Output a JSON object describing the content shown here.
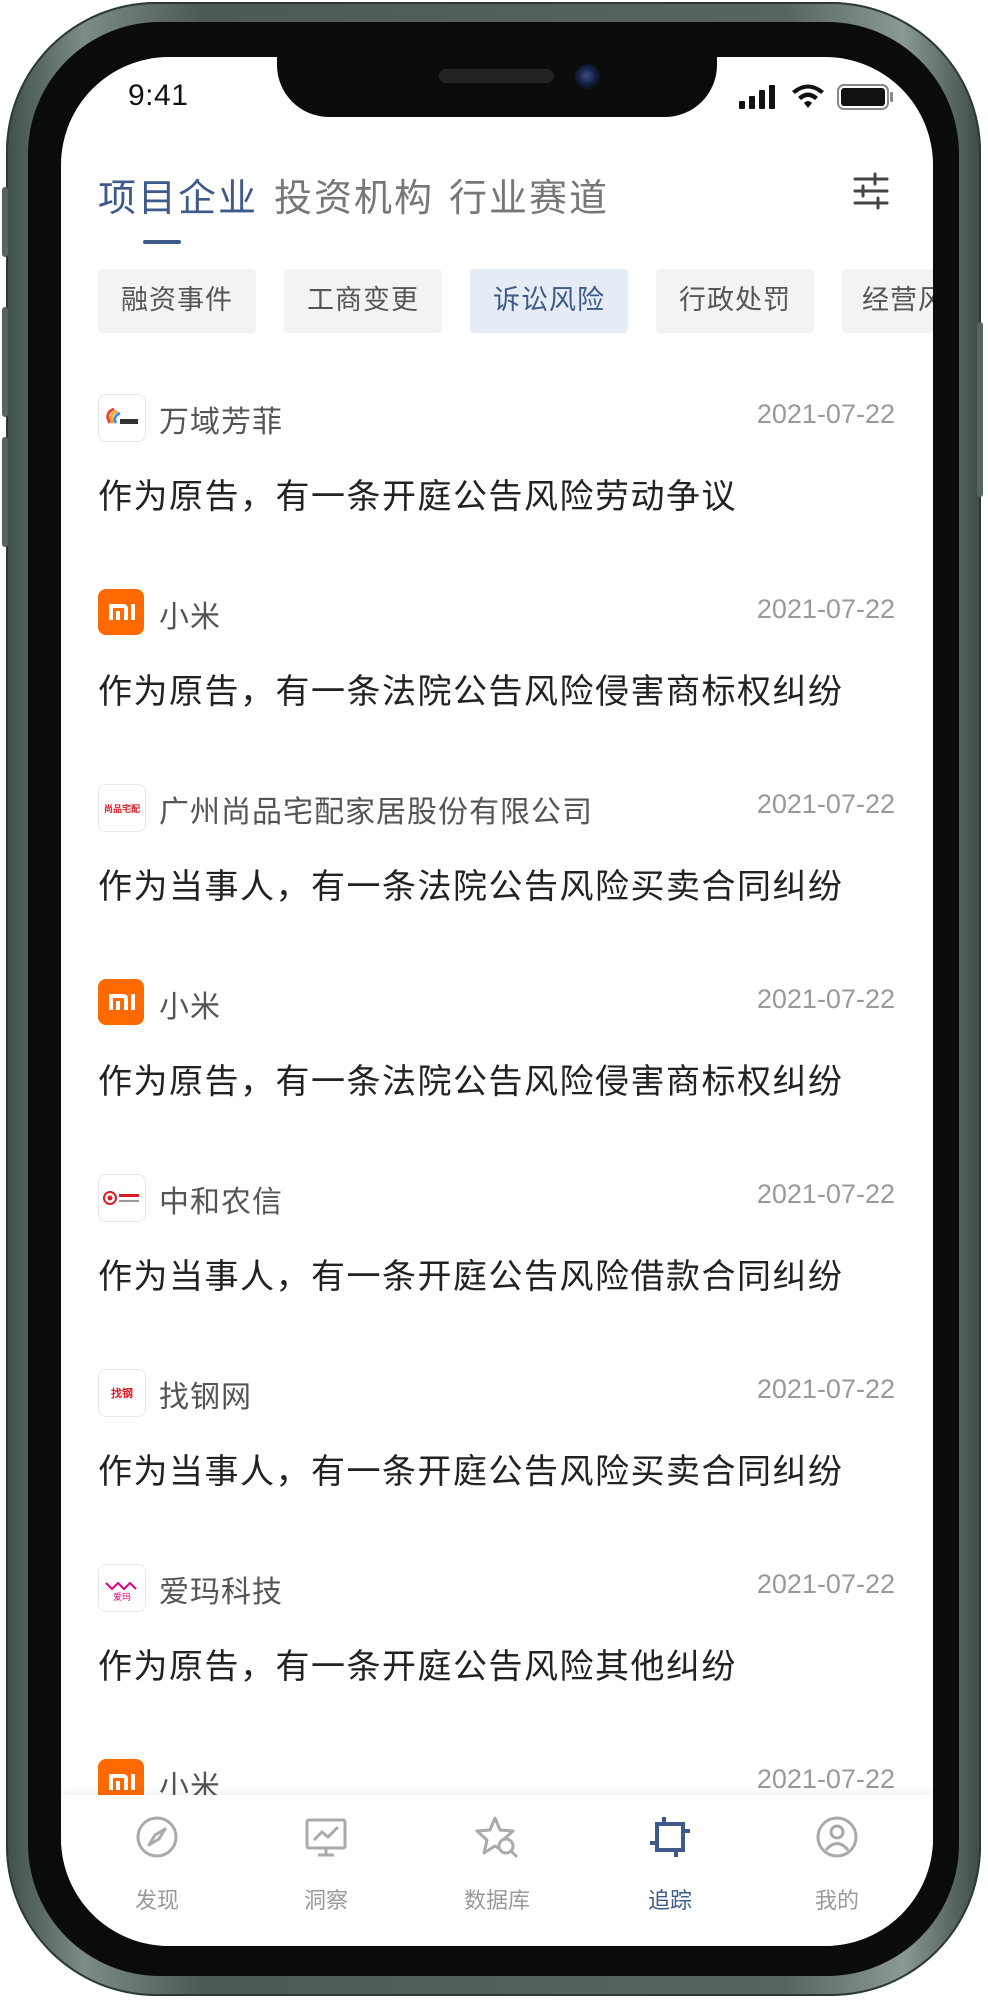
{
  "status_bar": {
    "time": "9:41"
  },
  "tabs": [
    {
      "label": "项目企业",
      "active": true
    },
    {
      "label": "投资机构",
      "active": false
    },
    {
      "label": "行业赛道",
      "active": false
    }
  ],
  "filter_chips": [
    {
      "label": "融资事件",
      "active": false
    },
    {
      "label": "工商变更",
      "active": false
    },
    {
      "label": "诉讼风险",
      "active": true
    },
    {
      "label": "行政处罚",
      "active": false
    },
    {
      "label": "经营风险",
      "active": false
    }
  ],
  "feed": [
    {
      "company": "万域芳菲",
      "date": "2021-07-22",
      "text": "作为原告，有一条开庭公告风险劳动争议",
      "logo": "wanyu-logo"
    },
    {
      "company": "小米",
      "date": "2021-07-22",
      "text": "作为原告，有一条法院公告风险侵害商标权纠纷",
      "logo": "xiaomi-logo"
    },
    {
      "company": "广州尚品宅配家居股份有限公司",
      "date": "2021-07-22",
      "text": "作为当事人，有一条法院公告风险买卖合同纠纷",
      "logo": "shangpin-logo"
    },
    {
      "company": "小米",
      "date": "2021-07-22",
      "text": "作为原告，有一条法院公告风险侵害商标权纠纷",
      "logo": "xiaomi-logo"
    },
    {
      "company": "中和农信",
      "date": "2021-07-22",
      "text": "作为当事人，有一条开庭公告风险借款合同纠纷",
      "logo": "zhonghe-logo"
    },
    {
      "company": "找钢网",
      "date": "2021-07-22",
      "text": "作为当事人，有一条开庭公告风险买卖合同纠纷",
      "logo": "zhaogang-logo"
    },
    {
      "company": "爱玛科技",
      "date": "2021-07-22",
      "text": "作为原告，有一条开庭公告风险其他纠纷",
      "logo": "aima-logo"
    },
    {
      "company": "小米",
      "date": "2021-07-22",
      "text": "",
      "logo": "xiaomi-logo"
    }
  ],
  "logo_text": {
    "xiaomi": "mi",
    "shangpin": "尚品宅配",
    "zhaogang": "找钢",
    "aima": "爱玛"
  },
  "bottom_nav": [
    {
      "label": "发现",
      "icon": "compass-icon",
      "active": false
    },
    {
      "label": "洞察",
      "icon": "chart-monitor-icon",
      "active": false
    },
    {
      "label": "数据库",
      "icon": "star-search-icon",
      "active": false
    },
    {
      "label": "追踪",
      "icon": "track-icon",
      "active": true
    },
    {
      "label": "我的",
      "icon": "user-icon",
      "active": false
    }
  ],
  "colors": {
    "accent": "#3d5a8a",
    "xiaomi_orange": "#ff6900",
    "inactive_text": "#999999"
  }
}
